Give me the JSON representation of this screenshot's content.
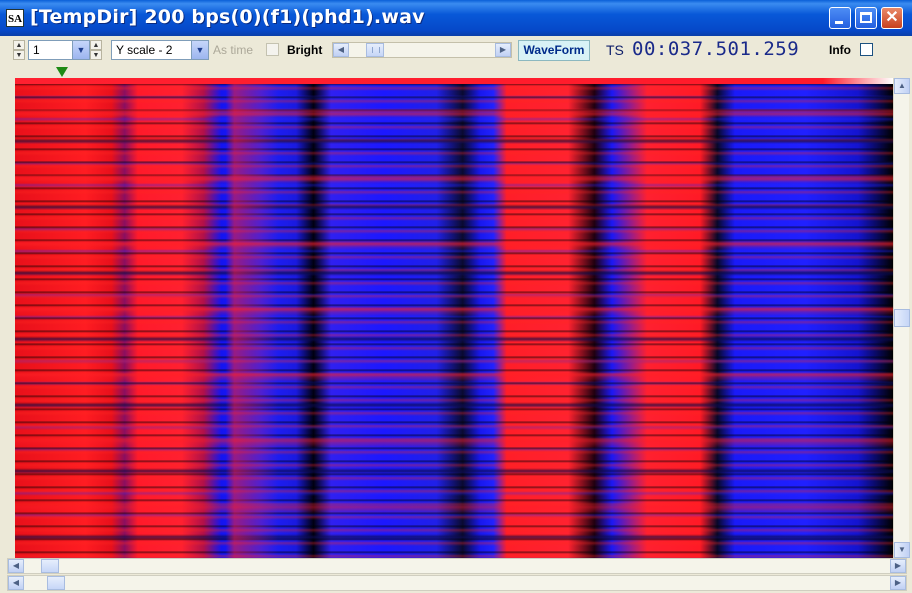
{
  "window": {
    "title": "[TempDir] 200 bps(0)(f1)(phd1).wav",
    "icon_text": "SA"
  },
  "toolbar": {
    "channel_value": "1",
    "yscale_value": "Y scale - 2",
    "as_time_label": "As time",
    "bright_label": "Bright",
    "waveform_label": "WaveForm",
    "ts_label": "TS",
    "ts_value": "00:037.501.259",
    "info_label": "Info"
  },
  "colors": {
    "titlebar": "#0648c8",
    "spectro_red": "#ff1c22",
    "spectro_blue": "#2020ff",
    "marker": "#1e8a14"
  },
  "icons": [
    "up-arrow-icon",
    "down-arrow-icon",
    "chevron-down-icon",
    "left-arrow-icon",
    "right-arrow-icon",
    "minimize-icon",
    "maximize-icon",
    "close-icon"
  ]
}
